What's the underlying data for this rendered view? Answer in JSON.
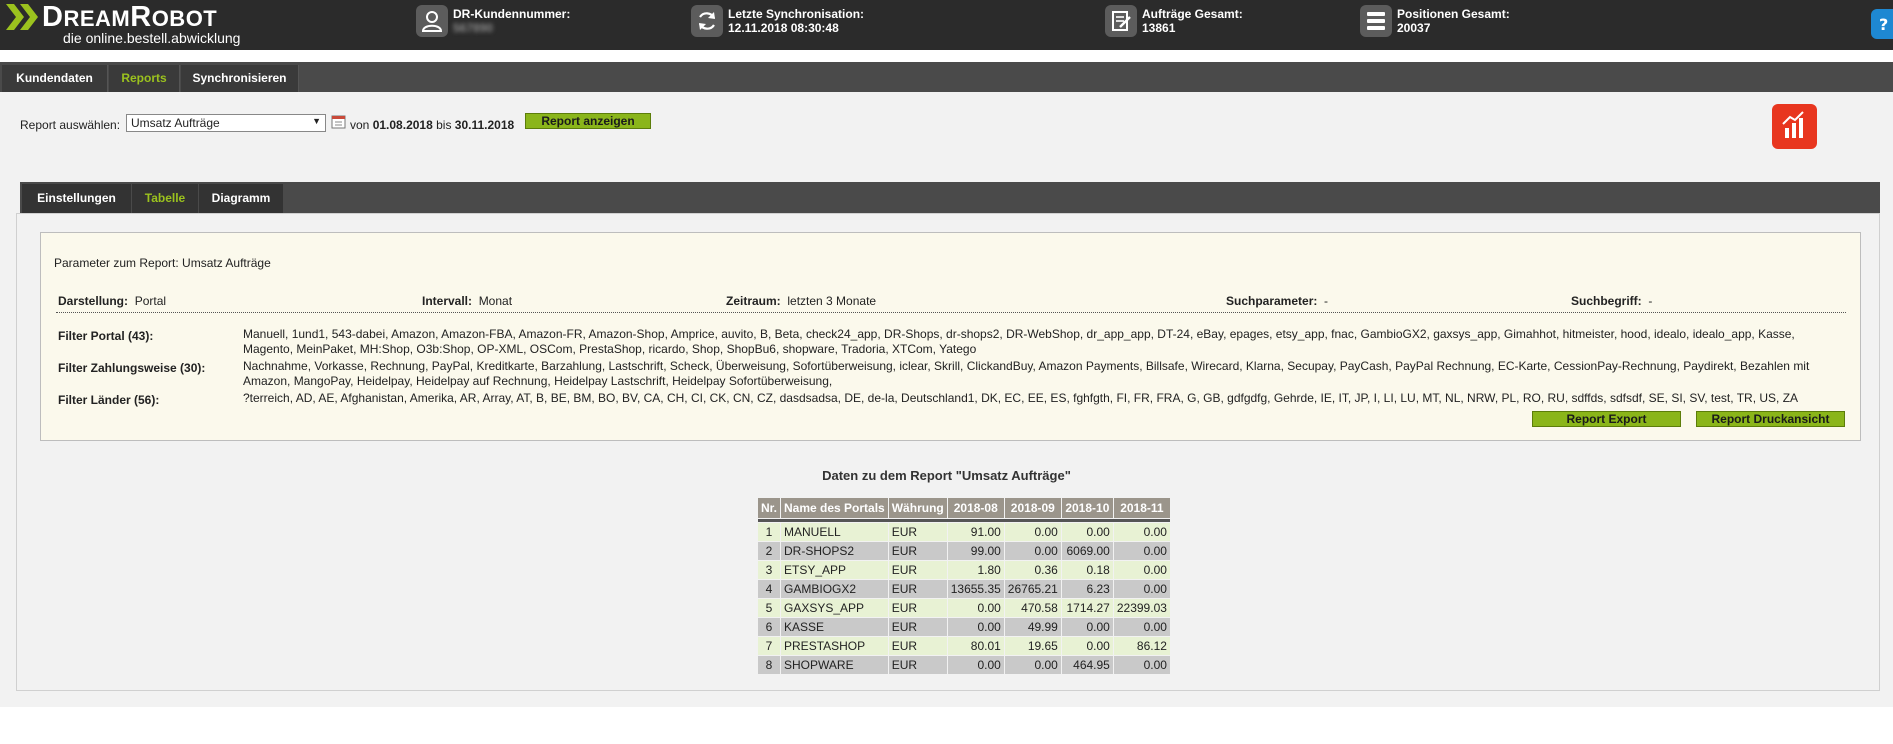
{
  "header": {
    "logo": {
      "brand_part1": "D",
      "brand_part2": "REAM",
      "brand_part3": "R",
      "brand_part4": "OBOT",
      "tagline": "die online.bestell.abwicklung"
    },
    "stats": [
      {
        "label": "DR-Kundennummer:",
        "value": "567890",
        "icon": "user-icon"
      },
      {
        "label": "Letzte Synchronisation:",
        "value": "12.11.2018 08:30:48",
        "icon": "sync-icon"
      },
      {
        "label": "Aufträge Gesamt:",
        "value": "13861",
        "icon": "orders-icon"
      },
      {
        "label": "Positionen Gesamt:",
        "value": "20037",
        "icon": "positions-icon"
      }
    ]
  },
  "nav": {
    "tabs": [
      {
        "label": "Kundendaten",
        "active": false
      },
      {
        "label": "Reports",
        "active": true
      },
      {
        "label": "Synchronisieren",
        "active": false
      }
    ]
  },
  "report": {
    "select_label": "Report auswählen:",
    "selected": "Umsatz Aufträge",
    "von": "von",
    "date_from": "01.08.2018",
    "bis": "bis",
    "date_to": "30.11.2018",
    "show_button": "Report anzeigen"
  },
  "subtabs": [
    {
      "label": "Einstellungen",
      "active": false
    },
    {
      "label": "Tabelle",
      "active": true
    },
    {
      "label": "Diagramm",
      "active": false
    }
  ],
  "params": {
    "title": "Parameter zum Report: Umsatz Aufträge",
    "darstellung_label": "Darstellung:",
    "darstellung_value": "Portal",
    "intervall_label": "Intervall:",
    "intervall_value": "Monat",
    "zeitraum_label": "Zeitraum:",
    "zeitraum_value": "letzten 3 Monate",
    "suchparameter_label": "Suchparameter:",
    "suchparameter_value": "-",
    "suchbegriff_label": "Suchbegriff:",
    "suchbegriff_value": "-",
    "filter_portal_label": "Filter Portal (43):",
    "filter_portal_value": "Manuell, 1und1, 543-dabei, Amazon, Amazon-FBA, Amazon-FR, Amazon-Shop, Amprice, auvito, B, Beta, check24_app, DR-Shops, dr-shops2, DR-WebShop, dr_app_app, DT-24, eBay, epages, etsy_app, fnac, GambioGX2, gaxsys_app, Gimahhot, hitmeister, hood, idealo, idealo_app, Kasse, Magento, MeinPaket, MH:Shop, O3b:Shop, OP-XML, OSCom, PrestaShop, ricardo, Shop, ShopBu6, shopware, Tradoria, XTCom, Yatego",
    "filter_zahlung_label": "Filter Zahlungsweise (30):",
    "filter_zahlung_value": "Nachnahme, Vorkasse, Rechnung, PayPal, Kreditkarte, Barzahlung, Lastschrift, Scheck, Überweisung, Sofortüberweisung, iclear, Skrill, ClickandBuy, Amazon Payments, Billsafe, Wirecard, Klarna, Secupay, PayCash, PayPal Rechnung, EC-Karte, CessionPay-Rechnung, Paydirekt, Bezahlen mit Amazon, MangoPay, Heidelpay, Heidelpay auf Rechnung, Heidelpay Lastschrift, Heidelpay Sofortüberweisung,",
    "filter_laender_label": "Filter Länder (56):",
    "filter_laender_value": "?terreich, AD, AE, Afghanistan, Amerika, AR, Array, AT, B, BE, BM, BO, BV, CA, CH, CI, CK, CN, CZ, dasdsadsa, DE, de-la, Deutschland1, DK, EC, EE, ES, fghfgth, FI, FR, FRA, G, GB, gdfgdfg, Gehrde, IE, IT, JP, I, LI, LU, MT, NL, NRW, PL, RO, RU, sdffds, sdfsdf, SE, SI, SV, test, TR, US, ZA",
    "export_button": "Report Export",
    "print_button": "Report Druckansicht"
  },
  "table": {
    "title": "Daten zu dem Report \"Umsatz Aufträge\"",
    "columns": [
      "Nr.",
      "Name des Portals",
      "Währung",
      "2018-08",
      "2018-09",
      "2018-10",
      "2018-11"
    ],
    "rows": [
      [
        "1",
        "MANUELL",
        "EUR",
        "91.00",
        "0.00",
        "0.00",
        "0.00"
      ],
      [
        "2",
        "DR-SHOPS2",
        "EUR",
        "99.00",
        "0.00",
        "6069.00",
        "0.00"
      ],
      [
        "3",
        "ETSY_APP",
        "EUR",
        "1.80",
        "0.36",
        "0.18",
        "0.00"
      ],
      [
        "4",
        "GAMBIOGX2",
        "EUR",
        "13655.35",
        "26765.21",
        "6.23",
        "0.00"
      ],
      [
        "5",
        "GAXSYS_APP",
        "EUR",
        "0.00",
        "470.58",
        "1714.27",
        "22399.03"
      ],
      [
        "6",
        "KASSE",
        "EUR",
        "0.00",
        "49.99",
        "0.00",
        "0.00"
      ],
      [
        "7",
        "PRESTASHOP",
        "EUR",
        "80.01",
        "19.65",
        "0.00",
        "86.12"
      ],
      [
        "8",
        "SHOPWARE",
        "EUR",
        "0.00",
        "0.00",
        "464.95",
        "0.00"
      ]
    ]
  },
  "colors": {
    "accent_green": "#8ab51a",
    "header_dark": "#2b2b2b",
    "chart_red": "#e8361f",
    "help_blue": "#1e88d2"
  }
}
